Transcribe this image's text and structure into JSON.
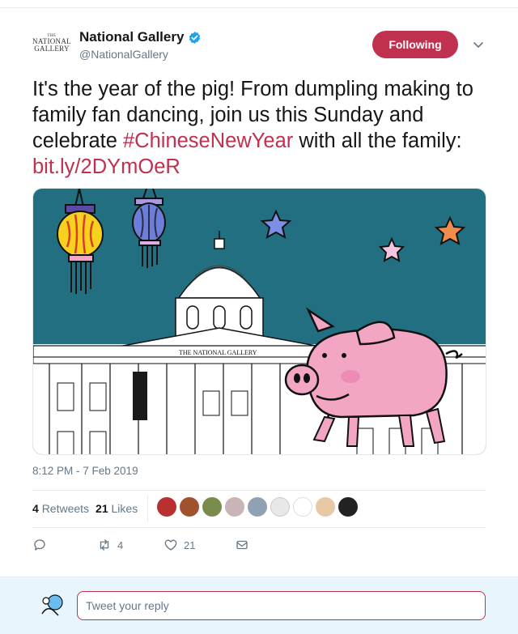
{
  "author": {
    "logo_the": "THE",
    "logo_line1": "NATIONAL",
    "logo_line2": "GALLERY",
    "name": "National Gallery",
    "handle": "@NationalGallery"
  },
  "follow_button": {
    "label": "Following"
  },
  "tweet": {
    "text_part1": "It's the year of the pig! From dumpling making to family fan dancing, join us this Sunday and celebrate ",
    "hashtag": "#ChineseNewYear",
    "text_part2": " with all the family: ",
    "link": "bit.ly/2DYmOeR",
    "image_building_sign": "THE NATIONAL GALLERY",
    "timestamp": "8:12 PM - 7 Feb 2019"
  },
  "stats": {
    "retweets_count": "4",
    "retweets_label": "Retweets",
    "likes_count": "21",
    "likes_label": "Likes"
  },
  "likers": [
    {
      "icon": "red-rose-avatar",
      "color": "#b8302f"
    },
    {
      "icon": "autumn-avatar",
      "color": "#a0522d"
    },
    {
      "icon": "plant-avatar",
      "color": "#7a8b4e"
    },
    {
      "icon": "eye-avatar",
      "color": "#c9b4b7"
    },
    {
      "icon": "default-avatar",
      "color": "#8fa1b3"
    },
    {
      "icon": "document-avatar",
      "color": "#e8e8e8"
    },
    {
      "icon": "text-logo-avatar",
      "color": "#ffffff"
    },
    {
      "icon": "man-avatar",
      "color": "#e7c9a5"
    },
    {
      "icon": "heart-pattern-avatar",
      "color": "#222222"
    }
  ],
  "actions": {
    "reply_count": "",
    "retweet_count": "4",
    "like_count": "21"
  },
  "reply": {
    "placeholder": "Tweet your reply"
  },
  "colors": {
    "accent": "#c0304f",
    "secondary_text": "#657786",
    "verified": "#1da1f2",
    "reply_bar": "#e8f5fd",
    "image_sky": "#236f82",
    "pig": "#f3a5c4"
  }
}
